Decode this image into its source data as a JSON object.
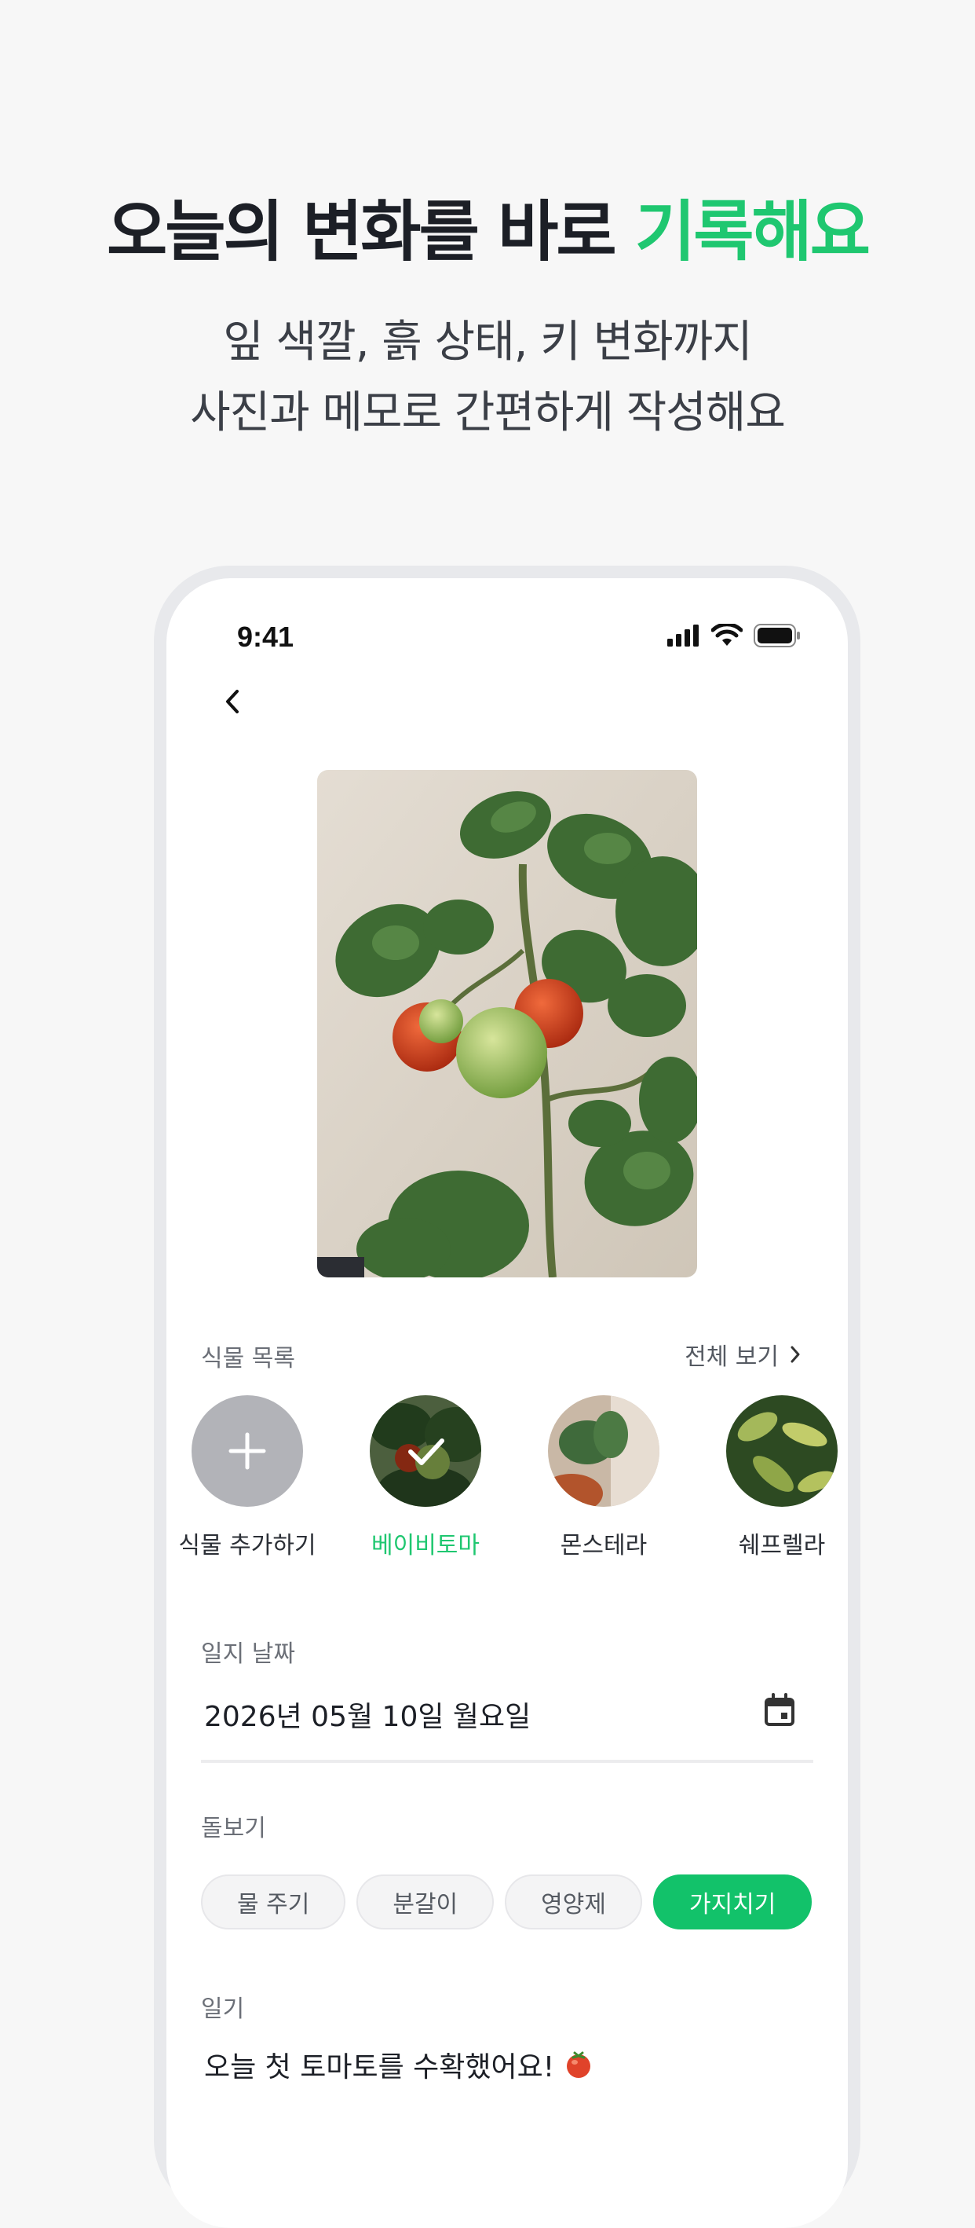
{
  "header": {
    "title_main": "오늘의 변화를 바로",
    "title_accent": "기록해요",
    "subtitle_line1": "잎 색깔, 흙 상태, 키 변화까지",
    "subtitle_line2": "사진과 메모로 간편하게 작성해요"
  },
  "status_bar": {
    "time": "9:41"
  },
  "plant_list": {
    "label": "식물 목록",
    "see_all": "전체 보기",
    "items": [
      {
        "name": "식물 추가하기",
        "icon": "plus-icon",
        "selected": false
      },
      {
        "name": "베이비토마",
        "selected": true
      },
      {
        "name": "몬스테라",
        "selected": false
      },
      {
        "name": "쉐프렐라",
        "selected": false
      }
    ]
  },
  "journal_date": {
    "label": "일지 날짜",
    "value": "2026년 05월 10일 월요일",
    "icon": "calendar-icon"
  },
  "care": {
    "label": "돌보기",
    "options": [
      {
        "label": "물 주기",
        "selected": false
      },
      {
        "label": "분갈이",
        "selected": false
      },
      {
        "label": "영양제",
        "selected": false
      },
      {
        "label": "가지치기",
        "selected": true
      }
    ]
  },
  "diary": {
    "label": "일기",
    "text": "오늘 첫 토마토를 수확했어요!",
    "emoji_icon": "tomato-icon"
  },
  "colors": {
    "accent": "#1fc770",
    "chip_active": "#12c26a"
  }
}
